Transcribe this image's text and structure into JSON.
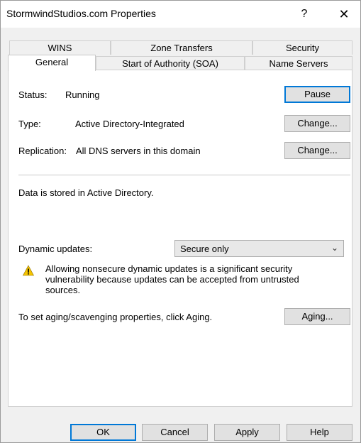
{
  "window": {
    "title": "StormwindStudios.com Properties",
    "help": "?",
    "close": "✕"
  },
  "tabs_back": [
    "WINS",
    "Zone Transfers",
    "Security"
  ],
  "tabs_front": [
    "General",
    "Start of Authority (SOA)",
    "Name Servers"
  ],
  "general": {
    "status_label": "Status:",
    "status_value": "Running",
    "pause_button": "Pause",
    "type_label": "Type:",
    "type_value": "Active Directory-Integrated",
    "type_change": "Change...",
    "replication_label": "Replication:",
    "replication_value": "All DNS servers in this domain",
    "replication_change": "Change...",
    "storage_text": "Data is stored in Active Directory.",
    "dyn_label": "Dynamic updates:",
    "dyn_value": "Secure only",
    "warning_text": "Allowing nonsecure dynamic updates is a significant security vulnerability because updates can be accepted from untrusted sources.",
    "aging_text": "To set aging/scavenging properties, click Aging.",
    "aging_button": "Aging..."
  },
  "footer": {
    "ok": "OK",
    "cancel": "Cancel",
    "apply": "Apply",
    "help": "Help"
  },
  "colors": {
    "accent": "#0078d7",
    "warning": "#f5c400"
  }
}
